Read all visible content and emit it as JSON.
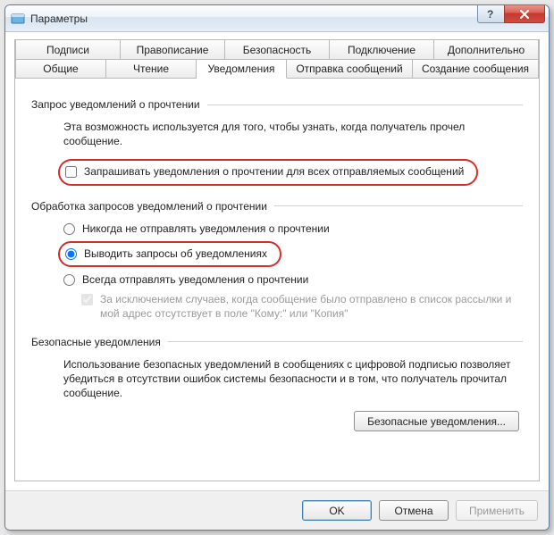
{
  "window": {
    "title": "Параметры"
  },
  "tabs": {
    "row1": [
      "Подписи",
      "Правописание",
      "Безопасность",
      "Подключение",
      "Дополнительно"
    ],
    "row2": [
      "Общие",
      "Чтение",
      "Уведомления",
      "Отправка сообщений",
      "Создание сообщения"
    ],
    "active": "Уведомления"
  },
  "sections": {
    "request": {
      "title": "Запрос уведомлений о прочтении",
      "desc": "Эта возможность используется для того, чтобы узнать, когда получатель прочел сообщение.",
      "opt1": "Запрашивать уведомления о прочтении для всех отправляемых сообщений"
    },
    "handle": {
      "title": "Обработка запросов уведомлений о прочтении",
      "never": "Никогда не отправлять уведомления о прочтении",
      "ask": "Выводить запросы об уведомлениях",
      "always": "Всегда отправлять уведомления о прочтении",
      "except": "За исключением случаев, когда сообщение было отправлено в список рассылки и мой адрес отсутствует в поле \"Кому:\" или \"Копия\""
    },
    "secure": {
      "title": "Безопасные уведомления",
      "desc": "Использование безопасных уведомлений в сообщениях с цифровой подписью позволяет убедиться в отсутствии ошибок системы безопасности и в том, что получатель прочитал сообщение.",
      "button": "Безопасные уведомления..."
    }
  },
  "footer": {
    "ok": "OK",
    "cancel": "Отмена",
    "apply": "Применить"
  }
}
